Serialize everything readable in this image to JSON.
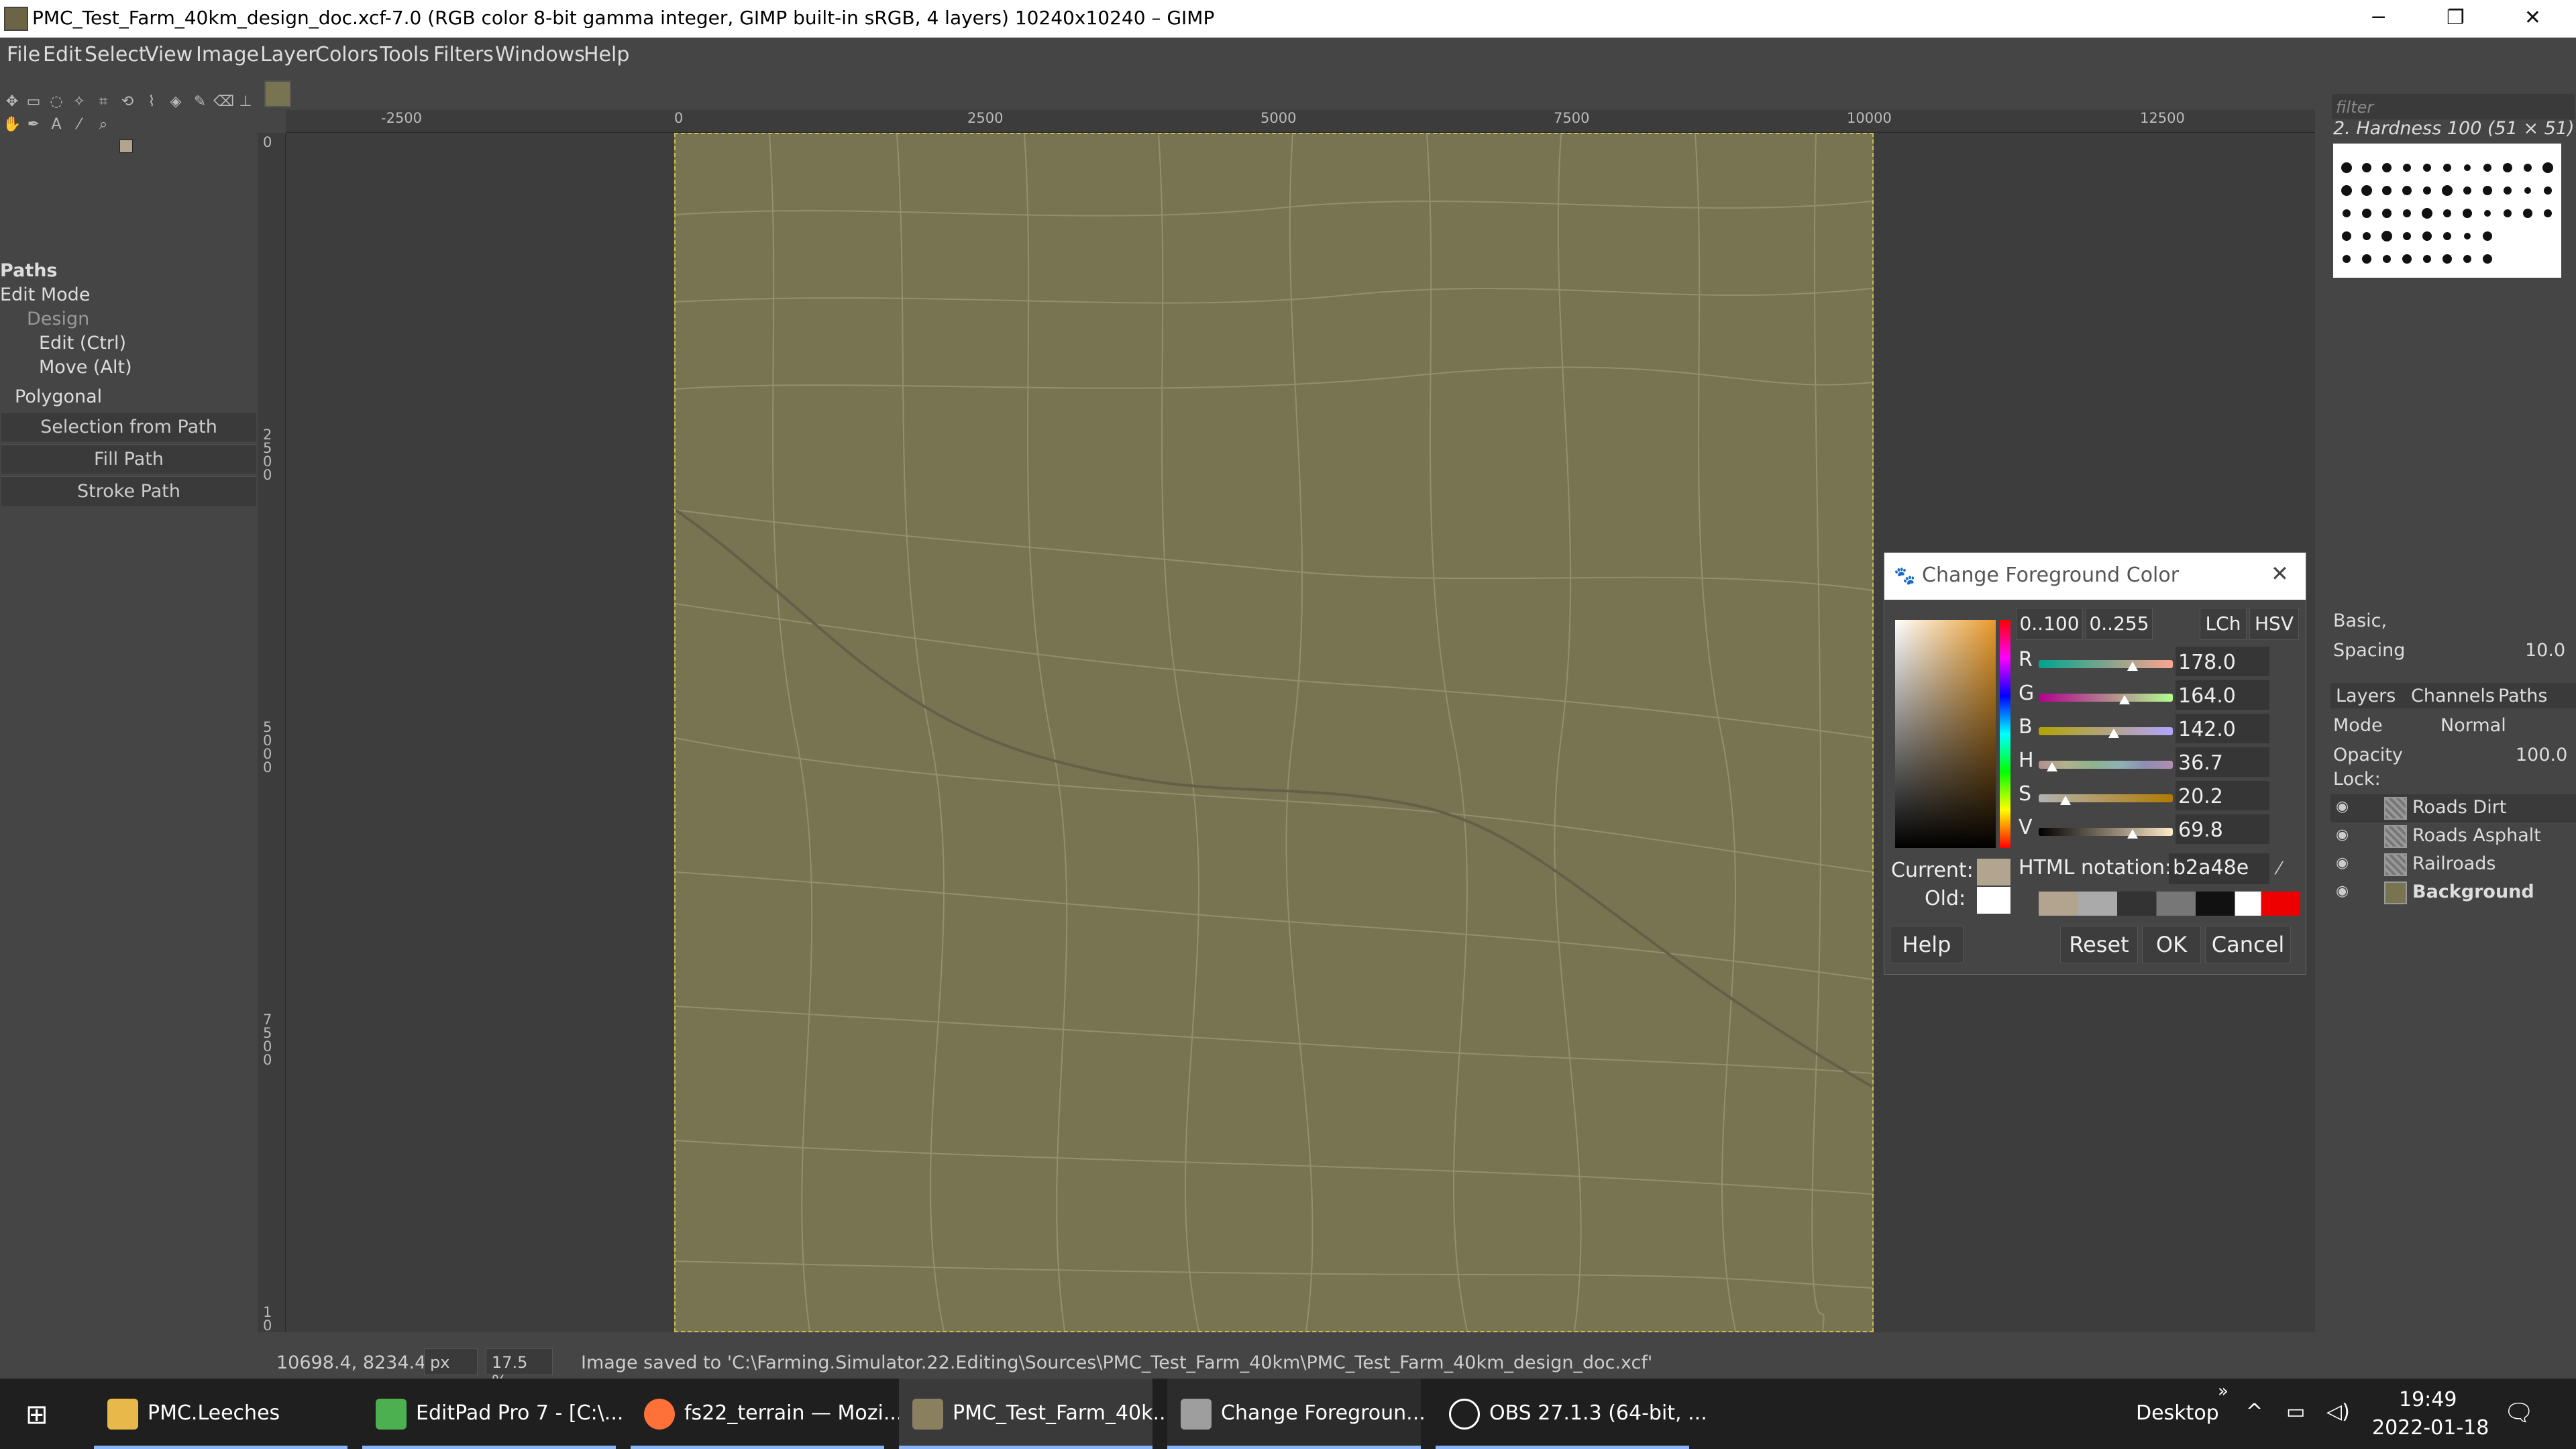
{
  "window": {
    "title": "PMC_Test_Farm_40km_design_doc.xcf-7.0 (RGB color 8-bit gamma integer, GIMP built-in sRGB, 4 layers) 10240x10240 – GIMP",
    "min": "─",
    "max": "❐",
    "close": "✕"
  },
  "menu": [
    "File",
    "Edit",
    "Select",
    "View",
    "Image",
    "Layer",
    "Colors",
    "Tools",
    "Filters",
    "Windows",
    "Help"
  ],
  "tool_options": {
    "title": "Paths",
    "edit_mode": "Edit Mode",
    "modes": [
      "Design",
      "Edit (Ctrl)",
      "Move (Alt)"
    ],
    "polygonal": "Polygonal",
    "buttons": [
      "Selection from Path",
      "Fill Path",
      "Stroke Path"
    ]
  },
  "rulers": {
    "h": [
      "-2500",
      "0",
      "2500",
      "5000",
      "7500",
      "10000",
      "12500"
    ],
    "v": [
      "0",
      "2500",
      "5000",
      "7500",
      "10"
    ]
  },
  "status": {
    "coords": "10698.4, 8234.4",
    "unit": "px",
    "zoom": "17.5 %",
    "message": "Image saved to 'C:\\Farming.Simulator.22.Editing\\Sources\\PMC_Test_Farm_40km\\PMC_Test_Farm_40km_design_doc.xcf'"
  },
  "brushes": {
    "filter_placeholder": "filter",
    "selected": "2. Hardness 100 (51 × 51)",
    "preset": "Basic,",
    "spacing_label": "Spacing",
    "spacing_value": "10.0"
  },
  "layers": {
    "tabs": [
      "Layers",
      "Channels",
      "Paths"
    ],
    "mode_label": "Mode",
    "mode_value": "Normal",
    "opacity_label": "Opacity",
    "opacity_value": "100.0",
    "lock_label": "Lock:",
    "items": [
      {
        "name": "Roads Dirt"
      },
      {
        "name": "Roads Asphalt"
      },
      {
        "name": "Railroads"
      },
      {
        "name": "Background"
      }
    ]
  },
  "dialog": {
    "title": "Change Foreground Color",
    "range_buttons": [
      "0..100",
      "0..255"
    ],
    "model_buttons": [
      "LCh",
      "HSV"
    ],
    "channels": [
      {
        "label": "R",
        "value": "178.0",
        "pos": 0.7
      },
      {
        "label": "G",
        "value": "164.0",
        "pos": 0.64
      },
      {
        "label": "B",
        "value": "142.0",
        "pos": 0.56
      },
      {
        "label": "H",
        "value": "36.7",
        "pos": 0.1
      },
      {
        "label": "S",
        "value": "20.2",
        "pos": 0.2
      },
      {
        "label": "V",
        "value": "69.8",
        "pos": 0.7
      }
    ],
    "current_label": "Current:",
    "old_label": "Old:",
    "html_label": "HTML notation:",
    "html_value": "b2a48e",
    "current_color": "#b2a48e",
    "old_color": "#ffffff",
    "buttons": {
      "help": "Help",
      "reset": "Reset",
      "ok": "OK",
      "cancel": "Cancel"
    }
  },
  "taskbar": {
    "items": [
      {
        "label": "PMC.Leeches",
        "color": "#e8b84a"
      },
      {
        "label": "EditPad Pro 7 - [C:\\...",
        "color": "#4caf50"
      },
      {
        "label": "fs22_terrain — Mozi...",
        "color": "#ff7139"
      },
      {
        "label": "PMC_Test_Farm_40k...",
        "color": "#8a8060"
      },
      {
        "label": "Change Foregroun...",
        "color": "#9e9e9e"
      },
      {
        "label": "OBS 27.1.3 (64-bit, ...",
        "color": "#ffffff"
      }
    ],
    "desktop": "Desktop",
    "time": "19:49",
    "date": "2022-01-18"
  },
  "colors": {
    "canvas": "#787351",
    "fg": "#b2a48e",
    "panel": "#454545"
  }
}
